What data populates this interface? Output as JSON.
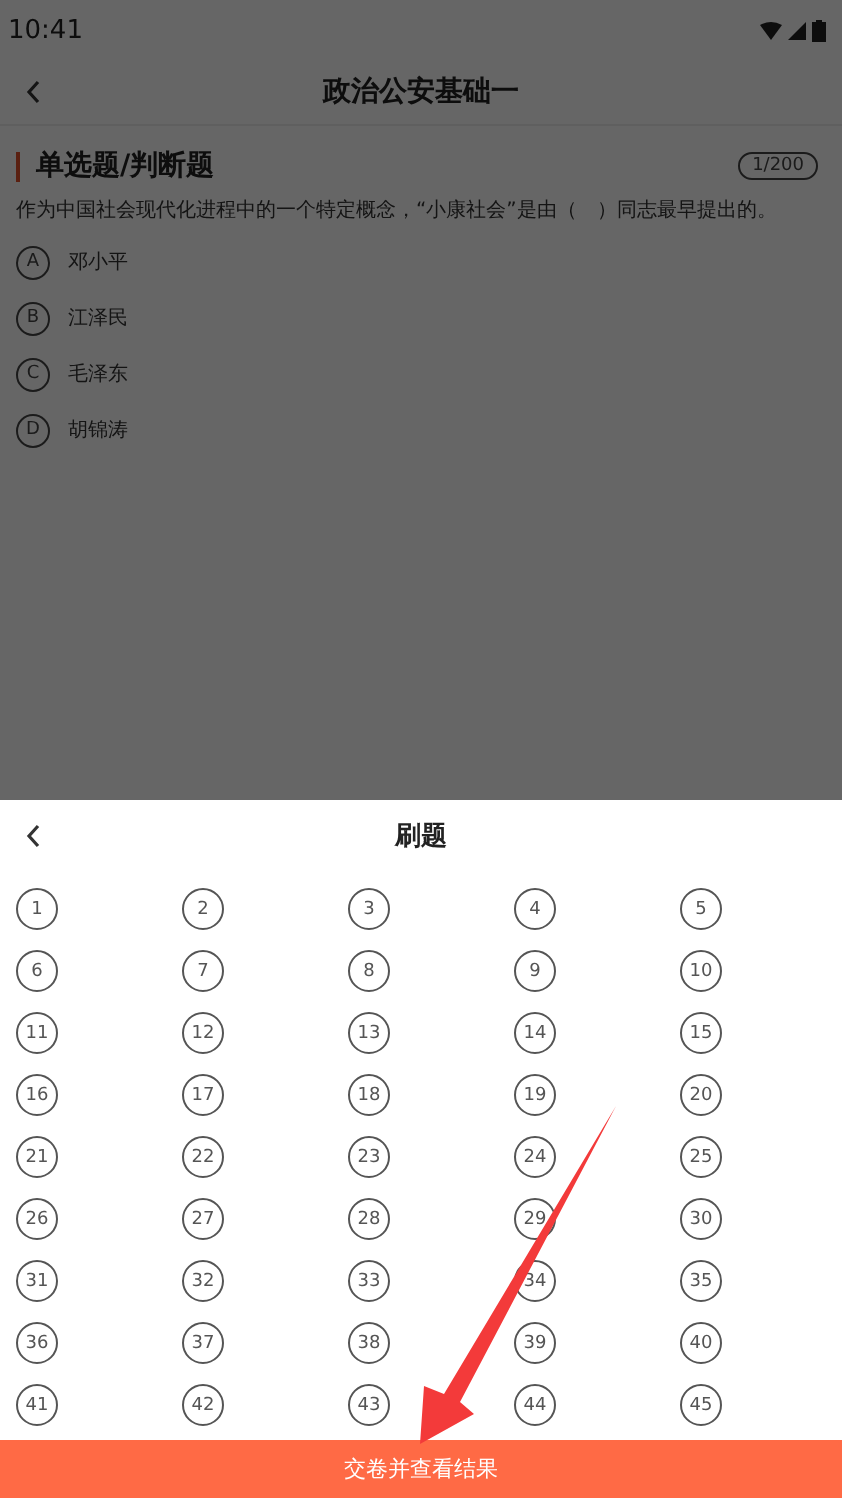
{
  "status_bar": {
    "time": "10:41"
  },
  "header": {
    "title": "政治公安基础一"
  },
  "question": {
    "section": "单选题/判断题",
    "counter": "1/200",
    "text": "作为中国社会现代化进程中的一个特定概念，“小康社会”是由（　）同志最早提出的。",
    "options": [
      {
        "letter": "A",
        "text": "邓小平"
      },
      {
        "letter": "B",
        "text": "江泽民"
      },
      {
        "letter": "C",
        "text": "毛泽东"
      },
      {
        "letter": "D",
        "text": "胡锦涛"
      }
    ]
  },
  "sheet": {
    "title": "刷题",
    "numbers": [
      "1",
      "2",
      "3",
      "4",
      "5",
      "6",
      "7",
      "8",
      "9",
      "10",
      "11",
      "12",
      "13",
      "14",
      "15",
      "16",
      "17",
      "18",
      "19",
      "20",
      "21",
      "22",
      "23",
      "24",
      "25",
      "26",
      "27",
      "28",
      "29",
      "30",
      "31",
      "32",
      "33",
      "34",
      "35",
      "36",
      "37",
      "38",
      "39",
      "40",
      "41",
      "42",
      "43",
      "44",
      "45"
    ],
    "submit": "交卷并查看结果"
  }
}
